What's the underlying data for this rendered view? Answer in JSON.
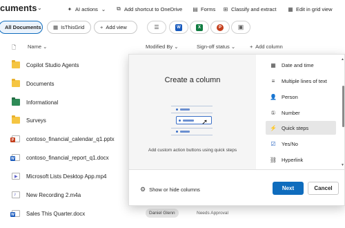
{
  "header": {
    "library_title": "cuments",
    "commands": [
      {
        "label": "AI actions",
        "icon": "sparkle-icon"
      },
      {
        "label": "Add shortcut to OneDrive",
        "icon": "shortcut-icon"
      },
      {
        "label": "Forms",
        "icon": "forms-icon"
      },
      {
        "label": "Classify and extract",
        "icon": "classify-icon"
      },
      {
        "label": "Edit in grid view",
        "icon": "grid-icon"
      }
    ]
  },
  "views": {
    "all_documents": "All Documents",
    "is_this_grid": "IsThisGrid",
    "add_view": "Add view"
  },
  "columns": {
    "name": "Name",
    "modified_by": "Modified By",
    "signoff_status": "Sign-off status",
    "add_column": "Add column"
  },
  "rows": [
    {
      "name": "Copilot Studio Agents",
      "type": "folder"
    },
    {
      "name": "Documents",
      "type": "folder"
    },
    {
      "name": "Informational",
      "type": "folder-green"
    },
    {
      "name": "Surveys",
      "type": "folder"
    },
    {
      "name": "contoso_financial_calendar_q1.pptx",
      "type": "pptx"
    },
    {
      "name": "contoso_financial_report_q1.docx",
      "type": "docx"
    },
    {
      "name": "Microsoft Lists Desktop App.mp4",
      "type": "video"
    },
    {
      "name": "New Recording 2.m4a",
      "type": "audio"
    },
    {
      "name": "Sales This Quarter.docx",
      "type": "docx",
      "modified_by": "Daniel Glenn",
      "signoff_status": "Needs Approval"
    }
  ],
  "panel": {
    "title": "Create a column",
    "description": "Add custom action buttons using quick steps",
    "column_types": [
      {
        "label": "Date and time",
        "icon": "calendar-icon"
      },
      {
        "label": "Multiple lines of text",
        "icon": "multiline-icon"
      },
      {
        "label": "Person",
        "icon": "person-icon"
      },
      {
        "label": "Number",
        "icon": "number-icon"
      },
      {
        "label": "Quick steps",
        "icon": "lightning-icon",
        "selected": true
      },
      {
        "label": "Yes/No",
        "icon": "yesno-icon"
      },
      {
        "label": "Hyperlink",
        "icon": "link-icon"
      }
    ],
    "show_hide": "Show or hide columns",
    "next": "Next",
    "cancel": "Cancel"
  },
  "colors": {
    "accent": "#0f6cbd",
    "folder": "#f5c542",
    "word": "#185abd",
    "excel": "#107c41",
    "powerpoint": "#c43e1c"
  }
}
